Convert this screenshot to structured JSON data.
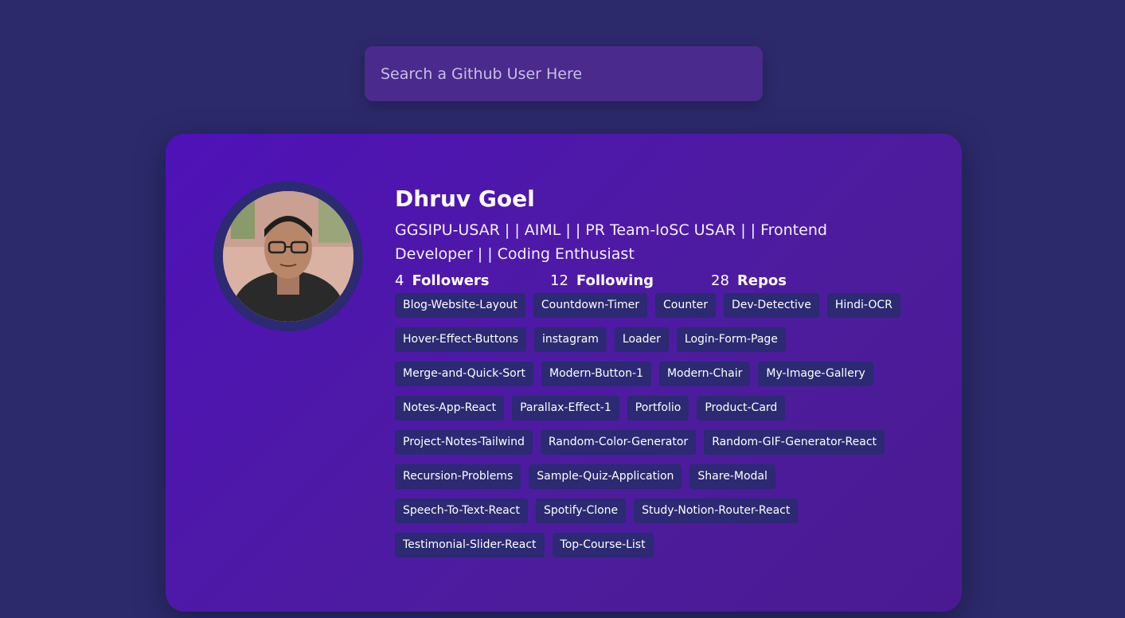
{
  "search": {
    "placeholder": "Search a Github User Here",
    "value": ""
  },
  "profile": {
    "name": "Dhruv Goel",
    "bio": "GGSIPU-USAR | | AIML | | PR Team-IoSC USAR | | Frontend Developer | | Coding Enthusiast",
    "avatar_description": "profile-photo"
  },
  "stats": {
    "followers": {
      "count": "4",
      "label": "Followers"
    },
    "following": {
      "count": "12",
      "label": "Following"
    },
    "repos": {
      "count": "28",
      "label": "Repos"
    }
  },
  "repositories": [
    "Blog-Website-Layout",
    "Countdown-Timer",
    "Counter",
    "Dev-Detective",
    "Hindi-OCR",
    "Hover-Effect-Buttons",
    "instagram",
    "Loader",
    "Login-Form-Page",
    "Merge-and-Quick-Sort",
    "Modern-Button-1",
    "Modern-Chair",
    "My-Image-Gallery",
    "Notes-App-React",
    "Parallax-Effect-1",
    "Portfolio",
    "Product-Card",
    "Project-Notes-Tailwind",
    "Random-Color-Generator",
    "Random-GIF-Generator-React",
    "Recursion-Problems",
    "Sample-Quiz-Application",
    "Share-Modal",
    "Speech-To-Text-React",
    "Spotify-Clone",
    "Study-Notion-Router-React",
    "Testimonial-Slider-React",
    "Top-Course-List"
  ],
  "colors": {
    "background": "#2c2a6b",
    "card": "#4f12b8",
    "search": "#4a2a8c",
    "tag": "#2b2a72"
  }
}
